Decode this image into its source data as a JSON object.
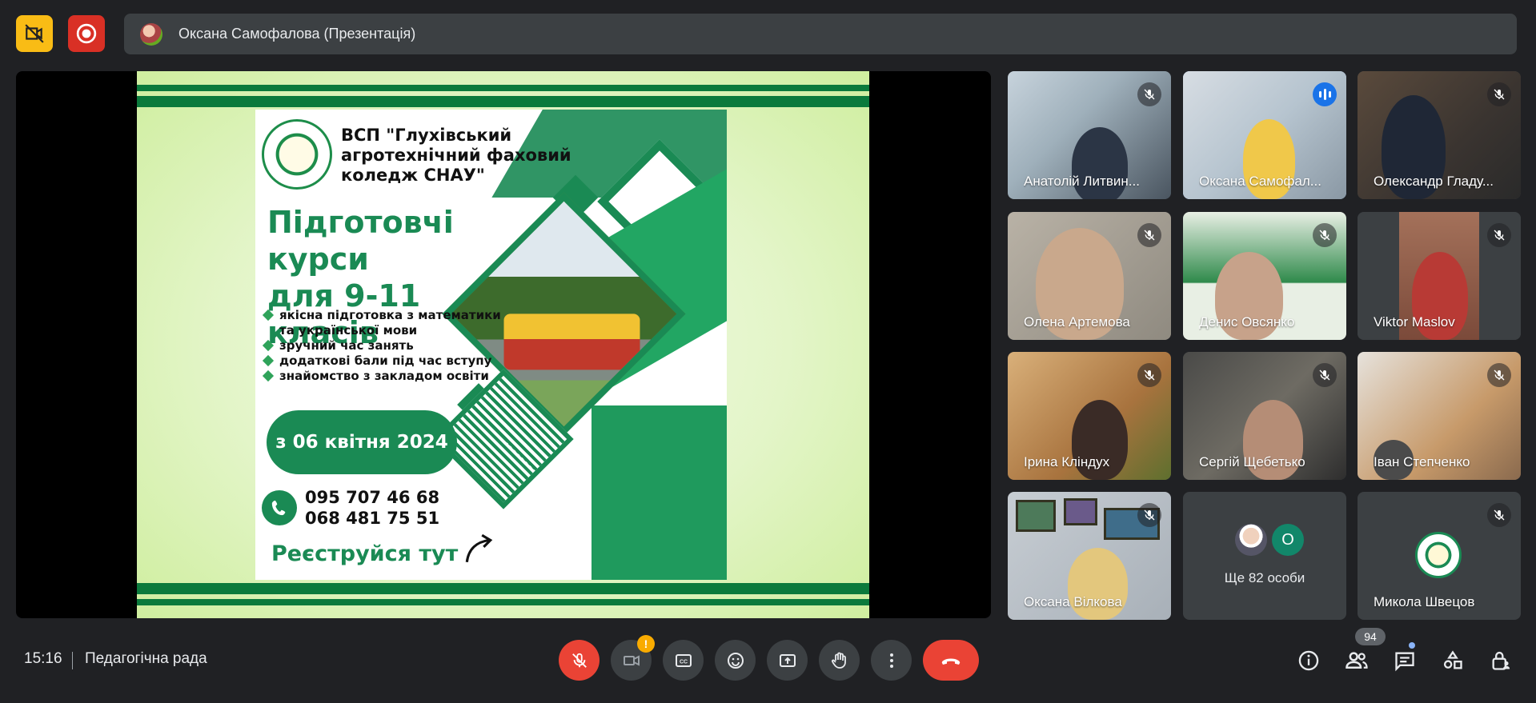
{
  "presenter": {
    "name": "Оксана Самофалова (Презентація)"
  },
  "slide": {
    "title": "ВСП \"Глухівський агротехнічний фаховий коледж СНАУ\"",
    "headline_line1": "Підготовчі курси",
    "headline_line2": "для 9-11 класів",
    "bullets": [
      "якісна підготовка з математики",
      "та української мови",
      "зручний час занять",
      "додаткові бали під час вступу",
      "знайомство з закладом освіти"
    ],
    "date": "з 06 квітня 2024",
    "phones": [
      "095 707 46 68",
      "068 481 75 51"
    ],
    "register": "Реєструйся тут"
  },
  "participants": [
    {
      "name": "Анатолій Литвин...",
      "muted": true
    },
    {
      "name": "Оксана Самофал...",
      "muted": false,
      "speaking": true
    },
    {
      "name": "Олександр Гладу...",
      "muted": true
    },
    {
      "name": "Олена Артемова",
      "muted": true
    },
    {
      "name": "Денис Овсянко",
      "muted": true
    },
    {
      "name": "Viktor Maslov",
      "muted": true
    },
    {
      "name": "Ірина Кліндух",
      "muted": true
    },
    {
      "name": "Сергій Щебетько",
      "muted": true
    },
    {
      "name": "Іван Степченко",
      "muted": true
    },
    {
      "name": "Оксана Вілкова",
      "muted": true
    },
    {
      "name": "Ще 82 особи",
      "avatar_letter": "O"
    },
    {
      "name": "Микола Швецов",
      "muted": true
    }
  ],
  "bottom": {
    "time": "15:16",
    "meeting_title": "Педагогічна рада",
    "people_count": "94",
    "camera_warning": "!"
  },
  "colors": {
    "accent": "#8ab4f8",
    "danger": "#ea4335",
    "bg": "#202124",
    "slide_green": "#1a8a54"
  }
}
